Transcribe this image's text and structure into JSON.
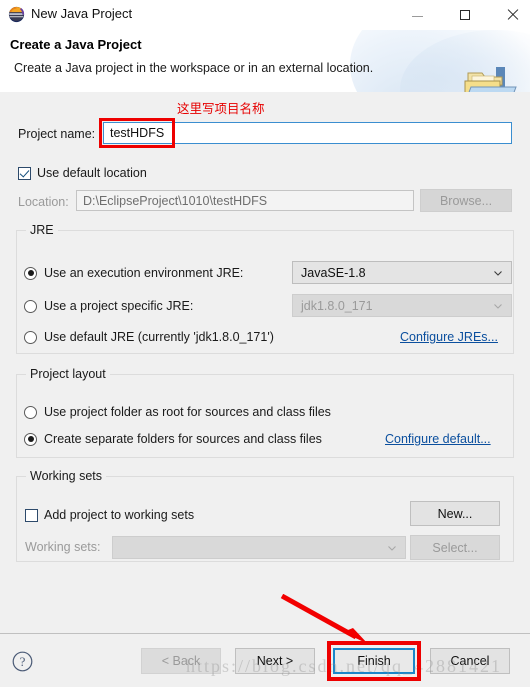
{
  "window": {
    "title": "New Java Project",
    "icon": "eclipse-logo-icon",
    "minimize_label": "Minimize",
    "maximize_label": "Maximize",
    "close_label": "Close"
  },
  "header": {
    "title": "Create a Java Project",
    "subtitle": "Create a Java project in the workspace or in an external location.",
    "icon": "java-project-folder-icon"
  },
  "annotations": {
    "project_name_note": "这里写项目名称",
    "note_color": "#e60000",
    "box_color": "#ee0000",
    "arrow_color": "#f20000"
  },
  "project_name": {
    "label": "Project name:",
    "value": "testHDFS",
    "placeholder": ""
  },
  "location": {
    "use_default_label": "Use default location",
    "use_default_checked": true,
    "label": "Location:",
    "value": "D:\\EclipseProject\\1010\\testHDFS",
    "browse_label": "Browse..."
  },
  "jre": {
    "group_title": "JRE",
    "options": [
      {
        "label": "Use an execution environment JRE:",
        "selected": true
      },
      {
        "label": "Use a project specific JRE:",
        "selected": false
      },
      {
        "label": "Use default JRE (currently 'jdk1.8.0_171')",
        "selected": false
      }
    ],
    "execution_environment_value": "JavaSE-1.8",
    "project_specific_value": "jdk1.8.0_171",
    "configure_link": "Configure JREs..."
  },
  "project_layout": {
    "group_title": "Project layout",
    "options": [
      {
        "label": "Use project folder as root for sources and class files",
        "selected": false
      },
      {
        "label": "Create separate folders for sources and class files",
        "selected": true
      }
    ],
    "configure_link": "Configure default..."
  },
  "working_sets": {
    "group_title": "Working sets",
    "add_label": "Add project to working sets",
    "add_checked": false,
    "new_label": "New...",
    "sets_label": "Working sets:",
    "sets_value": "",
    "select_label": "Select..."
  },
  "footer": {
    "help_icon": "help-question-icon",
    "back_label": "< Back",
    "next_label": "Next >",
    "finish_label": "Finish",
    "cancel_label": "Cancel"
  },
  "watermark": {
    "text": "https://blog.csdn.net/qq_42881421"
  }
}
